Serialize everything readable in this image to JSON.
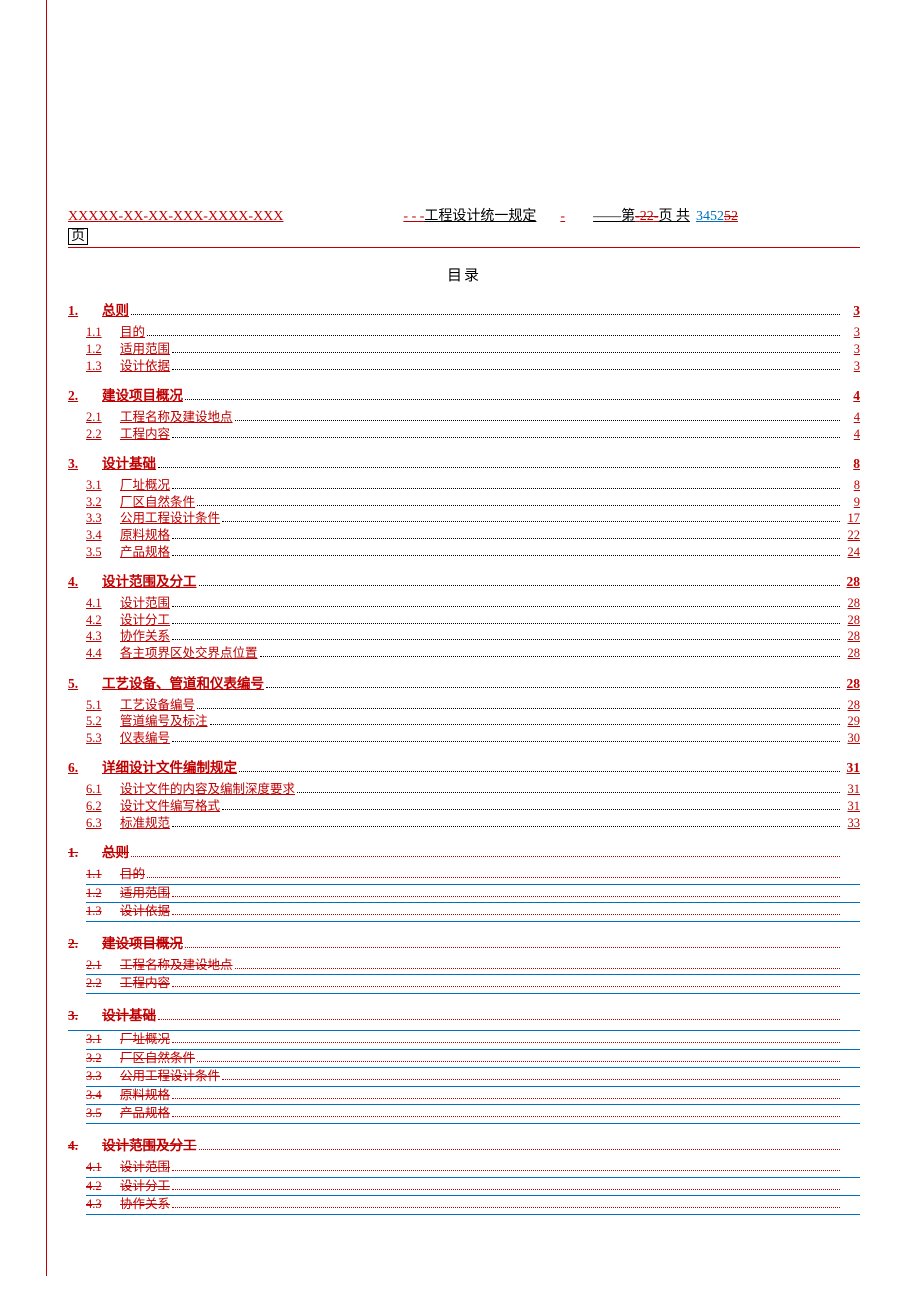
{
  "header": {
    "doc_code": "XXXXX-XX-XX-XXX-XXXX-XXX",
    "dashes": "- - -",
    "title_text": "工程设计统一规定",
    "page_prefix": "第",
    "page_old": "22",
    "page_sep": "页 共",
    "total_new": "3452",
    "total_old": "52",
    "page_suffix_wrap": "页"
  },
  "toc_title": "目录",
  "toc": [
    {
      "lvl": 1,
      "num": "1.",
      "label": "总则",
      "page": "3",
      "deleted": false
    },
    {
      "lvl": 2,
      "num": "1.1",
      "label": "目的",
      "page": "3",
      "deleted": false
    },
    {
      "lvl": 2,
      "num": "1.2",
      "label": "适用范围",
      "page": "3",
      "deleted": false
    },
    {
      "lvl": 2,
      "num": "1.3",
      "label": "设计依据",
      "page": "3",
      "deleted": false
    },
    {
      "lvl": 1,
      "num": "2.",
      "label": "建设项目概况",
      "page": "4",
      "deleted": false
    },
    {
      "lvl": 2,
      "num": "2.1",
      "label": "工程名称及建设地点",
      "page": "4",
      "deleted": false
    },
    {
      "lvl": 2,
      "num": "2.2",
      "label": "工程内容",
      "page": "4",
      "deleted": false
    },
    {
      "lvl": 1,
      "num": "3.",
      "label": "设计基础",
      "page": "8",
      "deleted": false
    },
    {
      "lvl": 2,
      "num": "3.1",
      "label": "厂址概况",
      "page": "8",
      "deleted": false
    },
    {
      "lvl": 2,
      "num": "3.2",
      "label": "厂区自然条件",
      "page": "9",
      "deleted": false
    },
    {
      "lvl": 2,
      "num": "3.3",
      "label": "公用工程设计条件",
      "page": "17",
      "deleted": false
    },
    {
      "lvl": 2,
      "num": "3.4",
      "label": "原料规格",
      "page": "22",
      "deleted": false
    },
    {
      "lvl": 2,
      "num": "3.5",
      "label": "产品规格",
      "page": "24",
      "deleted": false
    },
    {
      "lvl": 1,
      "num": "4.",
      "label": "设计范围及分工",
      "page": "28",
      "deleted": false
    },
    {
      "lvl": 2,
      "num": "4.1",
      "label": "设计范围",
      "page": "28",
      "deleted": false
    },
    {
      "lvl": 2,
      "num": "4.2",
      "label": "设计分工",
      "page": "28",
      "deleted": false
    },
    {
      "lvl": 2,
      "num": "4.3",
      "label": "协作关系",
      "page": "28",
      "deleted": false
    },
    {
      "lvl": 2,
      "num": "4.4",
      "label": "各主项界区处交界点位置",
      "page": "28",
      "deleted": false
    },
    {
      "lvl": 1,
      "num": "5.",
      "label": "工艺设备、管道和仪表编号",
      "page": "28",
      "deleted": false
    },
    {
      "lvl": 2,
      "num": "5.1",
      "label": "工艺设备编号",
      "page": "28",
      "deleted": false
    },
    {
      "lvl": 2,
      "num": "5.2",
      "label": "管道编号及标注",
      "page": "29",
      "deleted": false
    },
    {
      "lvl": 2,
      "num": "5.3",
      "label": "仪表编号",
      "page": "30",
      "deleted": false
    },
    {
      "lvl": 1,
      "num": "6.",
      "label": "详细设计文件编制规定",
      "page": "31",
      "deleted": false
    },
    {
      "lvl": 2,
      "num": "6.1",
      "label": "设计文件的内容及编制深度要求",
      "page": "31",
      "deleted": false
    },
    {
      "lvl": 2,
      "num": "6.2",
      "label": "设计文件编写格式",
      "page": "31",
      "deleted": false
    },
    {
      "lvl": 2,
      "num": "6.3",
      "label": "标准规范",
      "page": "33",
      "deleted": false
    },
    {
      "lvl": 1,
      "num": "1.",
      "label": "总则",
      "page": "",
      "deleted": true
    },
    {
      "lvl": 2,
      "num": "1.1",
      "label": "目的",
      "page": "",
      "deleted": true,
      "blueUnder": true
    },
    {
      "lvl": 2,
      "num": "1.2",
      "label": "适用范围",
      "page": "",
      "deleted": true,
      "blueUnder": true
    },
    {
      "lvl": 2,
      "num": "1.3",
      "label": "设计依据",
      "page": "",
      "deleted": true,
      "blueUnder": true
    },
    {
      "lvl": 1,
      "num": "2.",
      "label": "建设项目概况",
      "page": "",
      "deleted": true
    },
    {
      "lvl": 2,
      "num": "2.1",
      "label": "工程名称及建设地点",
      "page": "",
      "deleted": true,
      "blueUnder": true
    },
    {
      "lvl": 2,
      "num": "2.2",
      "label": "工程内容",
      "page": "",
      "deleted": true,
      "blueUnder": true
    },
    {
      "lvl": 1,
      "num": "3.",
      "label": "设计基础",
      "page": "",
      "deleted": true,
      "blueUnder": true
    },
    {
      "lvl": 2,
      "num": "3.1",
      "label": "厂址概况",
      "page": "",
      "deleted": true,
      "blueUnder": true
    },
    {
      "lvl": 2,
      "num": "3.2",
      "label": "厂区自然条件",
      "page": "",
      "deleted": true,
      "blueUnder": true
    },
    {
      "lvl": 2,
      "num": "3.3",
      "label": "公用工程设计条件",
      "page": "",
      "deleted": true,
      "blueUnder": true
    },
    {
      "lvl": 2,
      "num": "3.4",
      "label": "原料规格",
      "page": "",
      "deleted": true,
      "blueUnder": true
    },
    {
      "lvl": 2,
      "num": "3.5",
      "label": "产品规格",
      "page": "",
      "deleted": true,
      "blueUnder": true
    },
    {
      "lvl": 1,
      "num": "4.",
      "label": "设计范围及分工",
      "page": "",
      "deleted": true
    },
    {
      "lvl": 2,
      "num": "4.1",
      "label": "设计范围",
      "page": "",
      "deleted": true,
      "blueUnder": true
    },
    {
      "lvl": 2,
      "num": "4.2",
      "label": "设计分工",
      "page": "",
      "deleted": true,
      "blueUnder": true
    },
    {
      "lvl": 2,
      "num": "4.3",
      "label": "协作关系",
      "page": "",
      "deleted": true,
      "blueUnder": true
    }
  ]
}
